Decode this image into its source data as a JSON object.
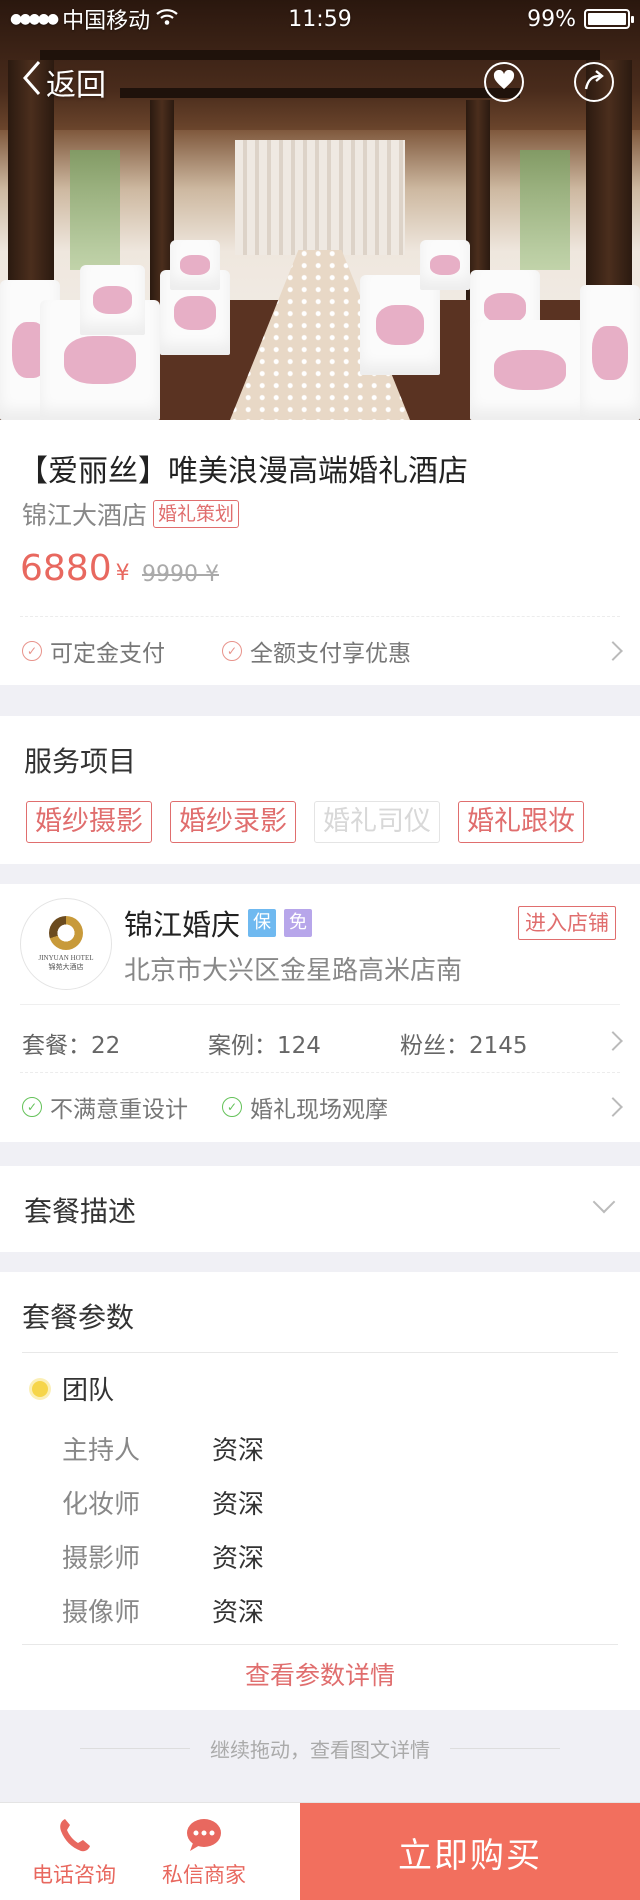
{
  "statusbar": {
    "carrier": "中国移动",
    "time": "11:59",
    "battery": "99%",
    "battery_level": 0.99
  },
  "hero": {
    "back_label": "返回",
    "favorite_icon": "heart-icon",
    "share_icon": "share-icon"
  },
  "product": {
    "title": "【爱丽丝】唯美浪漫高端婚礼酒店",
    "shop": "锦江大酒店",
    "category_tag": "婚礼策划",
    "price": "6880",
    "currency": "¥",
    "original_price": "9990 ¥",
    "features": [
      "可定金支付",
      "全额支付享优惠"
    ]
  },
  "services": {
    "title": "服务项目",
    "items": [
      {
        "label": "婚纱摄影",
        "active": true
      },
      {
        "label": "婚纱录影",
        "active": true
      },
      {
        "label": "婚礼司仪",
        "active": false
      },
      {
        "label": "婚礼跟妆",
        "active": true
      }
    ]
  },
  "store": {
    "logo_line1": "JINYUAN HOTEL",
    "logo_line2": "锦苑大酒店",
    "name": "锦江婚庆",
    "badge_guarantee": "保",
    "badge_free": "免",
    "badge_colors": {
      "guarantee": "#6fb9f0",
      "free": "#b7a6ea"
    },
    "address": "北京市大兴区金星路高米店南",
    "enter_label": "进入店铺",
    "stats": {
      "packages": "套餐：22",
      "cases": "案例：124",
      "fans": "粉丝：2145"
    },
    "features": [
      "不满意重设计",
      "婚礼现场观摩"
    ]
  },
  "description": {
    "title": "套餐描述"
  },
  "params": {
    "title": "套餐参数",
    "group": "团队",
    "rows": [
      {
        "key": "主持人",
        "value": "资深"
      },
      {
        "key": "化妆师",
        "value": "资深"
      },
      {
        "key": "摄影师",
        "value": "资深"
      },
      {
        "key": "摄像师",
        "value": "资深"
      }
    ],
    "more_label": "查看参数详情"
  },
  "drag_hint": "继续拖动，查看图文详情",
  "bottombar": {
    "call_label": "电话咨询",
    "message_label": "私信商家",
    "buy_label": "立即购买"
  },
  "colors": {
    "accent": "#e8685f",
    "buy_button": "#f26f5e",
    "green_check": "#65c25a"
  }
}
